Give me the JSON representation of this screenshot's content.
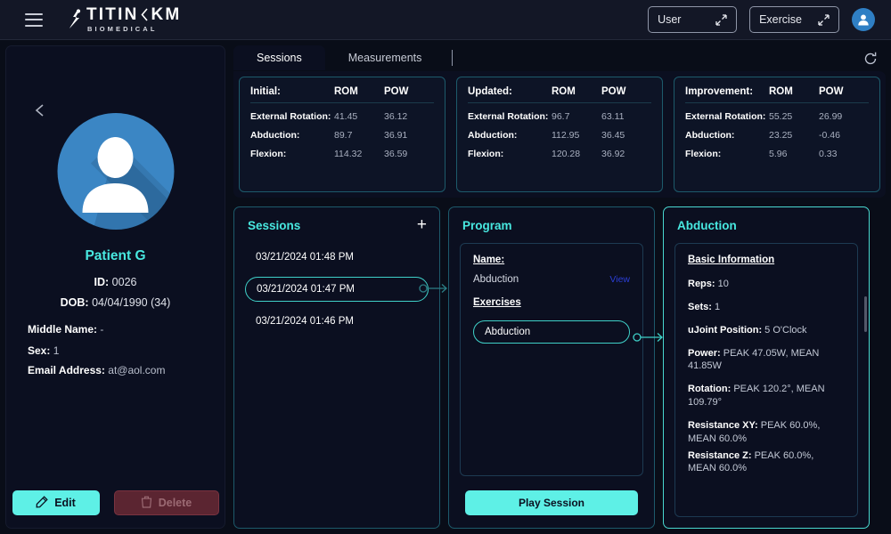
{
  "header": {
    "menu_icon": "hamburger-icon",
    "logo_main": "TITIN",
    "logo_km": "KM",
    "logo_sub": "BIOMEDICAL",
    "user_button": "User",
    "exercise_button": "Exercise",
    "avatar_icon": "user-avatar-icon"
  },
  "sidebar": {
    "back_icon": "back-arrow-icon",
    "avatar_icon": "patient-avatar-icon",
    "patient_name": "Patient G",
    "id_label": "ID:",
    "id_value": "0026",
    "dob_label": "DOB:",
    "dob_value": "04/04/1990 (34)",
    "middle_name_label": "Middle Name:",
    "middle_name_value": "-",
    "sex_label": "Sex:",
    "sex_value": "1",
    "email_label": "Email Address:",
    "email_value": "at@aol.com",
    "edit_button": "Edit",
    "delete_button": "Delete"
  },
  "tabs": [
    {
      "label": "Sessions",
      "active": true
    },
    {
      "label": "Measurements",
      "active": false
    }
  ],
  "refresh_icon": "refresh-icon",
  "metrics": {
    "columns": [
      "ROM",
      "POW"
    ],
    "cards": [
      {
        "title": "Initial:",
        "rows": [
          {
            "label": "External Rotation:",
            "rom": "41.45",
            "pow": "36.12"
          },
          {
            "label": "Abduction:",
            "rom": "89.7",
            "pow": "36.91"
          },
          {
            "label": "Flexion:",
            "rom": "114.32",
            "pow": "36.59"
          }
        ]
      },
      {
        "title": "Updated:",
        "rows": [
          {
            "label": "External Rotation:",
            "rom": "96.7",
            "pow": "63.11"
          },
          {
            "label": "Abduction:",
            "rom": "112.95",
            "pow": "36.45"
          },
          {
            "label": "Flexion:",
            "rom": "120.28",
            "pow": "36.92"
          }
        ]
      },
      {
        "title": "Improvement:",
        "rows": [
          {
            "label": "External Rotation:",
            "rom": "55.25",
            "pow": "26.99"
          },
          {
            "label": "Abduction:",
            "rom": "23.25",
            "pow": "-0.46"
          },
          {
            "label": "Flexion:",
            "rom": "5.96",
            "pow": "0.33"
          }
        ]
      }
    ]
  },
  "sessions_panel": {
    "title": "Sessions",
    "add_icon": "plus-icon",
    "items": [
      {
        "label": "03/21/2024 01:48 PM",
        "selected": false
      },
      {
        "label": "03/21/2024 01:47 PM",
        "selected": true
      },
      {
        "label": "03/21/2024 01:46 PM",
        "selected": false
      }
    ]
  },
  "program_panel": {
    "title": "Program",
    "name_label": "Name:",
    "name_value": "Abduction",
    "view_link": "View",
    "exercises_label": "Exercises",
    "exercise_item": "Abduction",
    "play_button": "Play Session"
  },
  "detail_panel": {
    "title": "Abduction",
    "info_title": "Basic Information",
    "rows": [
      {
        "label": "Reps:",
        "value": "10"
      },
      {
        "label": "Sets:",
        "value": "1"
      },
      {
        "label": "uJoint Position:",
        "value": "5 O'Clock"
      },
      {
        "label": "Power:",
        "value": "PEAK 47.05W, MEAN 41.85W"
      },
      {
        "label": "Rotation:",
        "value": "PEAK 120.2°, MEAN 109.79°"
      },
      {
        "label": "Resistance XY:",
        "value": "PEAK 60.0%, MEAN 60.0%"
      },
      {
        "label": "Resistance Z:",
        "value": "PEAK 60.0%, MEAN 60.0%"
      }
    ]
  },
  "colors": {
    "accent_cyan": "#5ef0e6",
    "panel_border": "#1d5a6b",
    "background": "#090d18",
    "panel_bg": "#0b0f20",
    "avatar_blue": "#3b86c4",
    "delete_red": "#5b2531",
    "link_blue": "#2b3ed6"
  }
}
